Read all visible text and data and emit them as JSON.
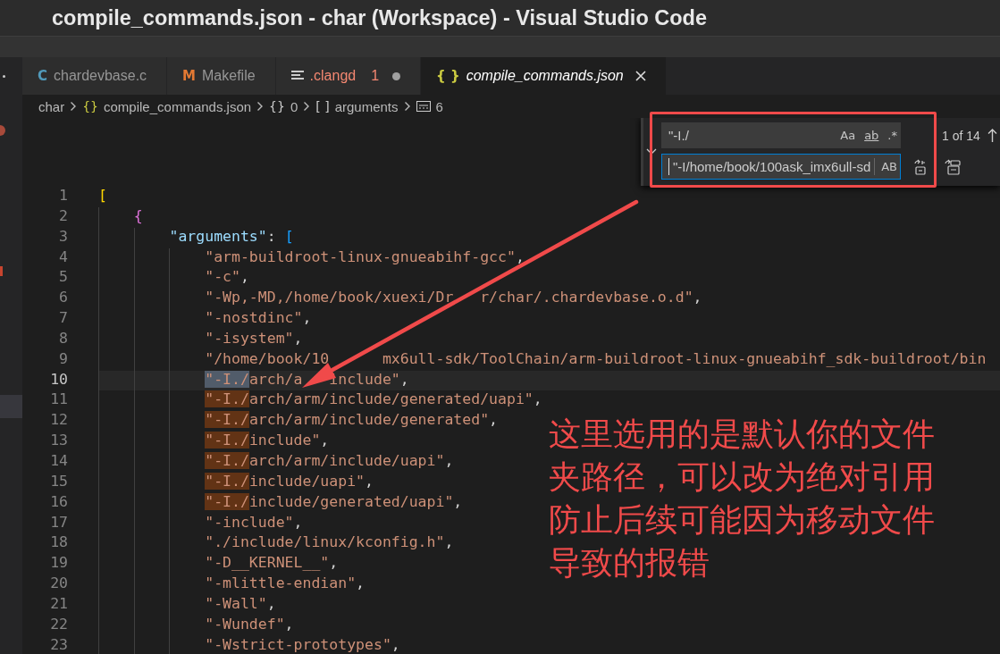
{
  "window": {
    "title": "compile_commands.json - char (Workspace) - Visual Studio Code"
  },
  "tabs": [
    {
      "label": "chardevbase.c",
      "icon": {
        "kind": "glyph",
        "text": "C",
        "color": "#519aba"
      },
      "selected": false,
      "preview": false,
      "error": false,
      "modified": false
    },
    {
      "label": "Makefile",
      "icon": {
        "kind": "glyph",
        "text": "M",
        "color": "#e37933"
      },
      "selected": false,
      "preview": false,
      "error": false,
      "modified": false
    },
    {
      "label": ".clangd",
      "icon": {
        "kind": "lines",
        "color": "#cccccc"
      },
      "selected": false,
      "preview": false,
      "error": true,
      "problems": "1",
      "modified": true
    },
    {
      "label": "compile_commands.json",
      "icon": {
        "kind": "glyph",
        "text": "{ }",
        "color": "#cbcb41"
      },
      "selected": true,
      "preview": true,
      "error": false,
      "modified": false
    }
  ],
  "breadcrumbs": [
    {
      "label": "char"
    },
    {
      "glyph": "{}",
      "color": "#cbcb41",
      "label": "compile_commands.json"
    },
    {
      "glyph": "{}",
      "color": "#cccccc",
      "label": "0"
    },
    {
      "glyph": "[ ]",
      "color": "#cccccc",
      "label": "arguments"
    },
    {
      "kind": "string",
      "label": "6"
    }
  ],
  "code": [
    {
      "number": "1",
      "tokens": [
        {
          "kind": "bracket",
          "text": "[",
          "color": "#ffd700"
        }
      ],
      "children": [
        {
          "number": "2",
          "tokens": [
            {
              "kind": "bracket",
              "text": "{",
              "color": "#da70d6"
            }
          ],
          "children": [
            {
              "number": "3",
              "tokens": [
                {
                  "kind": "key",
                  "text": "\"arguments\""
                },
                {
                  "kind": "punct",
                  "text": ": "
                },
                {
                  "kind": "bracket",
                  "text": "[",
                  "color": "#179fff"
                }
              ],
              "children": [
                {
                  "number": "4",
                  "tokens": [
                    {
                      "kind": "string",
                      "text": "\"arm-buildroot-linux-gnueabihf-gcc\""
                    },
                    {
                      "kind": "punct",
                      "text": ","
                    }
                  ]
                },
                {
                  "number": "5",
                  "tokens": [
                    {
                      "kind": "string",
                      "text": "\"-c\""
                    },
                    {
                      "kind": "punct",
                      "text": ","
                    }
                  ]
                },
                {
                  "number": "6",
                  "tokens": [
                    {
                      "kind": "string",
                      "text": "\"-Wp,-MD,/home/book/xuexi/Dr"
                    },
                    {
                      "kind": "covered"
                    },
                    {
                      "kind": "string",
                      "text": "r/char/.chardevbase.o.d\""
                    },
                    {
                      "kind": "punct",
                      "text": ","
                    }
                  ]
                },
                {
                  "number": "7",
                  "tokens": [
                    {
                      "kind": "string",
                      "text": "\"-nostdinc\""
                    },
                    {
                      "kind": "punct",
                      "text": ","
                    }
                  ]
                },
                {
                  "number": "8",
                  "tokens": [
                    {
                      "kind": "string",
                      "text": "\"-isystem\""
                    },
                    {
                      "kind": "punct",
                      "text": ","
                    }
                  ]
                },
                {
                  "number": "9",
                  "tokens": [
                    {
                      "kind": "string",
                      "text": "\"/home/book/10"
                    },
                    {
                      "kind": "covered"
                    },
                    {
                      "kind": "covered"
                    },
                    {
                      "kind": "string",
                      "text": "mx6ull-sdk/ToolChain/arm-buildroot-linux-gnueabihf_sdk-buildroot/bin"
                    }
                  ]
                },
                {
                  "number": "10",
                  "current": true,
                  "tokens": [
                    {
                      "kind": "string",
                      "text": "\"-I./",
                      "selected": true
                    },
                    {
                      "kind": "string",
                      "text": "arch/a"
                    },
                    {
                      "kind": "covered"
                    },
                    {
                      "kind": "string",
                      "text": "include\""
                    },
                    {
                      "kind": "punct",
                      "text": ","
                    }
                  ]
                },
                {
                  "number": "11",
                  "tokens": [
                    {
                      "kind": "string",
                      "text": "\"-I./",
                      "match": true
                    },
                    {
                      "kind": "string",
                      "text": "arch/arm/include/generated/uapi\""
                    },
                    {
                      "kind": "punct",
                      "text": ","
                    }
                  ]
                },
                {
                  "number": "12",
                  "tokens": [
                    {
                      "kind": "string",
                      "text": "\"-I./",
                      "match": true
                    },
                    {
                      "kind": "string",
                      "text": "arch/arm/include/generated\""
                    },
                    {
                      "kind": "punct",
                      "text": ","
                    }
                  ]
                },
                {
                  "number": "13",
                  "tokens": [
                    {
                      "kind": "string",
                      "text": "\"-I./",
                      "match": true
                    },
                    {
                      "kind": "string",
                      "text": "include\""
                    },
                    {
                      "kind": "punct",
                      "text": ","
                    }
                  ]
                },
                {
                  "number": "14",
                  "tokens": [
                    {
                      "kind": "string",
                      "text": "\"-I./",
                      "match": true
                    },
                    {
                      "kind": "string",
                      "text": "arch/arm/include/uapi\""
                    },
                    {
                      "kind": "punct",
                      "text": ","
                    }
                  ]
                },
                {
                  "number": "15",
                  "tokens": [
                    {
                      "kind": "string",
                      "text": "\"-I./",
                      "match": true
                    },
                    {
                      "kind": "string",
                      "text": "include/uapi\""
                    },
                    {
                      "kind": "punct",
                      "text": ","
                    }
                  ]
                },
                {
                  "number": "16",
                  "tokens": [
                    {
                      "kind": "string",
                      "text": "\"-I./",
                      "match": true
                    },
                    {
                      "kind": "string",
                      "text": "include/generated/uapi\""
                    },
                    {
                      "kind": "punct",
                      "text": ","
                    }
                  ]
                },
                {
                  "number": "17",
                  "tokens": [
                    {
                      "kind": "string",
                      "text": "\"-include\""
                    },
                    {
                      "kind": "punct",
                      "text": ","
                    }
                  ]
                },
                {
                  "number": "18",
                  "tokens": [
                    {
                      "kind": "string",
                      "text": "\"./include/linux/kconfig.h\""
                    },
                    {
                      "kind": "punct",
                      "text": ","
                    }
                  ]
                },
                {
                  "number": "19",
                  "tokens": [
                    {
                      "kind": "string",
                      "text": "\"-D__KERNEL__\""
                    },
                    {
                      "kind": "punct",
                      "text": ","
                    }
                  ]
                },
                {
                  "number": "20",
                  "tokens": [
                    {
                      "kind": "string",
                      "text": "\"-mlittle-endian\""
                    },
                    {
                      "kind": "punct",
                      "text": ","
                    }
                  ]
                },
                {
                  "number": "21",
                  "tokens": [
                    {
                      "kind": "string",
                      "text": "\"-Wall\""
                    },
                    {
                      "kind": "punct",
                      "text": ","
                    }
                  ]
                },
                {
                  "number": "22",
                  "tokens": [
                    {
                      "kind": "string",
                      "text": "\"-Wundef\""
                    },
                    {
                      "kind": "punct",
                      "text": ","
                    }
                  ]
                },
                {
                  "number": "23",
                  "tokens": [
                    {
                      "kind": "string",
                      "text": "\"-Wstrict-prototypes\""
                    },
                    {
                      "kind": "punct",
                      "text": ","
                    }
                  ]
                }
              ]
            }
          ]
        }
      ]
    }
  ],
  "find_widget": {
    "expanded": true,
    "find": {
      "value": "\"-I./",
      "options": [
        {
          "glyph": "Aa",
          "underline": false,
          "on": false
        },
        {
          "glyph": "ab",
          "underline": true,
          "on": false
        },
        {
          "glyph": ".*",
          "underline": false,
          "on": false
        }
      ]
    },
    "count": "1 of 14",
    "replace": {
      "value": "\"-I/home/book/100ask_imx6ull-sd",
      "focused": true,
      "preserve_case": {
        "glyph": "AB",
        "on": false
      }
    }
  },
  "annotation": {
    "text": "这里选用的是默认你的文件夹路径，可以改为绝对引用防止后续可能因为移动文件导致的报错"
  }
}
